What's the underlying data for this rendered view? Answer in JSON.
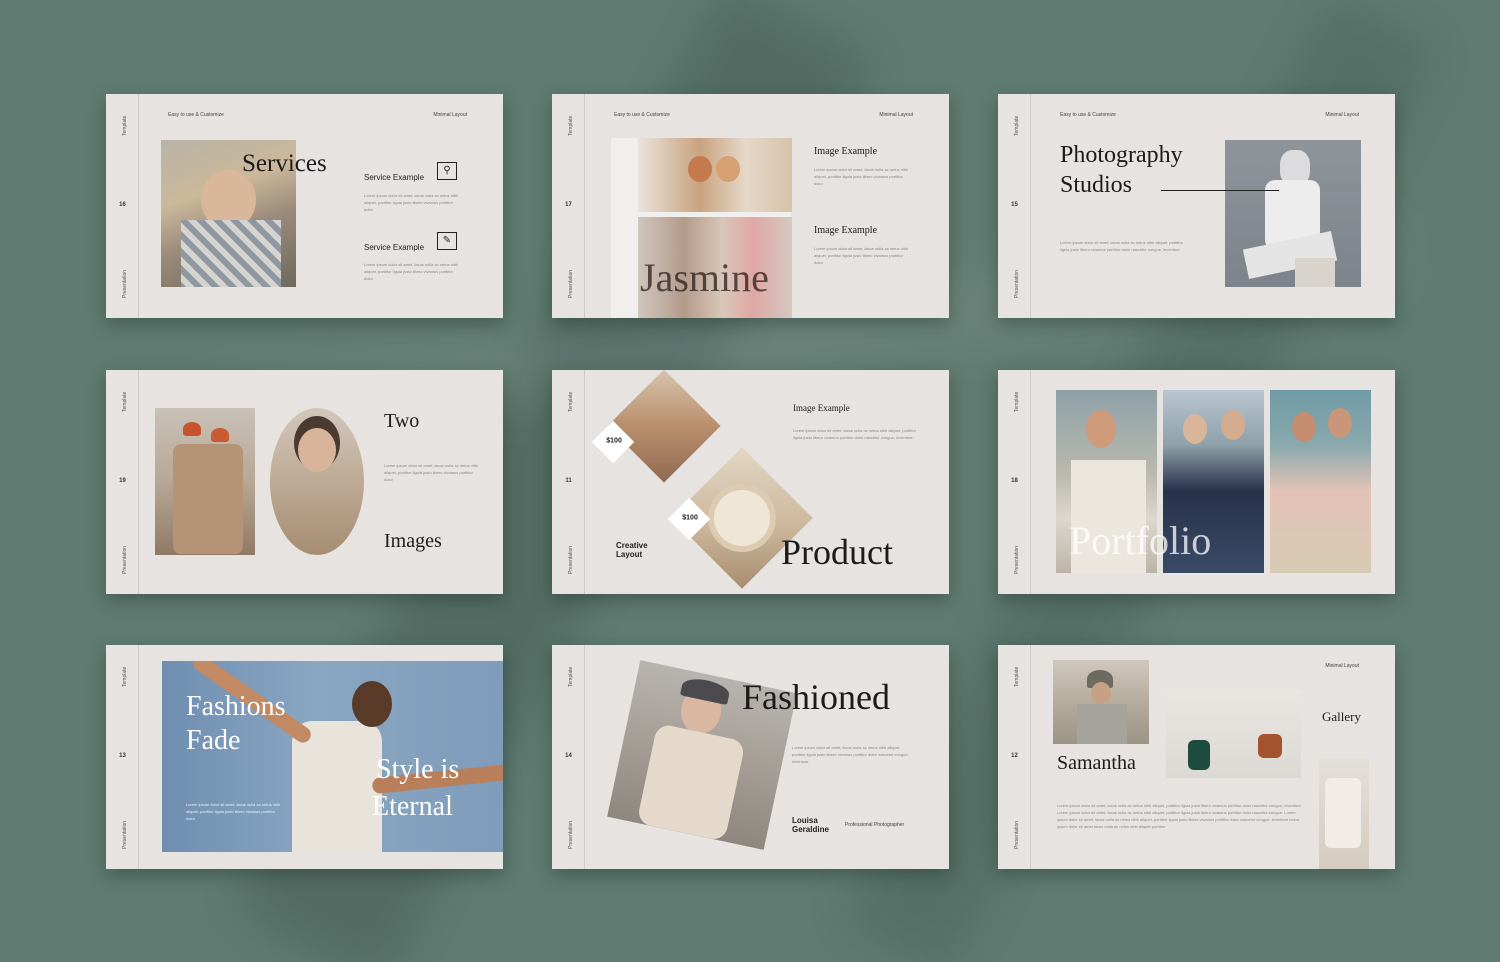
{
  "colors": {
    "background": "#5f7b72",
    "slide": "#e6e3e1",
    "text": "#1b1b1b",
    "muted": "#8a8683"
  },
  "common": {
    "rail_top": "Template",
    "rail_bottom": "Presentation",
    "tag_left": "Easy to use & Customize",
    "tag_right": "Minimal Layout"
  },
  "lorem": {
    "a": "Lorem ipsum dolor sit amet, lacus nulla ac netus nibh aliquet, porttitor ligula justo libero vivamus porttitor dolor nascetur congue, inventore",
    "b": "Lorem ipsum dolor sit amet, lacus nulla ac netus nibh aliquet, porttitor ligula justo libero vivamus porttitor dolor",
    "c": "Lorem ipsum dolor sit amet, lacus nulla ac netus nibh aliquet, porttitor ligula justo libero vivamus porttitor dolor nascetur congue, inventore Lorem ipsum dolor sit amet, lacus nulla ac netus nibh aliquet, porttitor ligula justo libero vivamus porttitor dolor nascetur congue. Lorem ipsum dolor sit amet, lacus nulla ac netus nibh aliquet, porttitor ligula justo libero vivamus porttitor dolor nascetur congue, inventore lorem ipsum dolor sit amet lacus nulla ac netus nibh aliquet porttitor"
  },
  "slides": {
    "services": {
      "page": "16",
      "title": "Services",
      "item1": "Service Example",
      "item2": "Service Example",
      "icon1": "lightbulb-icon",
      "icon2": "edit-icon"
    },
    "jasmine": {
      "page": "17",
      "overlay": "Jasmine",
      "item1": "Image Example",
      "item2": "Image Example"
    },
    "studios": {
      "page": "15",
      "title1": "Photography",
      "title2": "Studios"
    },
    "two_images": {
      "page": "19",
      "title1": "Two",
      "title2": "Images"
    },
    "product": {
      "page": "11",
      "label": "Image Example",
      "price1": "$100",
      "price2": "$100",
      "sub1": "Creative",
      "sub2": "Layout",
      "title": "Product"
    },
    "portfolio": {
      "page": "18",
      "title": "Portfolio"
    },
    "fashions": {
      "page": "13",
      "title1": "Fashions",
      "title2": "Fade",
      "title3": "Style is",
      "title4": "Eternal"
    },
    "fashioned": {
      "page": "14",
      "title": "Fashioned",
      "name1": "Louisa",
      "name2": "Geraldine",
      "role": "Professional Photographer"
    },
    "gallery": {
      "page": "12",
      "tag": "Minimal Layout",
      "title": "Gallery",
      "name": "Samantha"
    }
  }
}
